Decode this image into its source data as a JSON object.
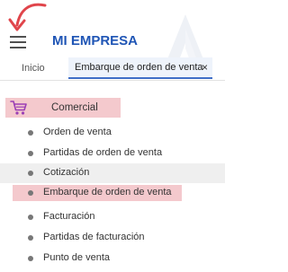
{
  "header": {
    "brand": "MI EMPRESA"
  },
  "tabs": {
    "home": "Inicio",
    "active": "Embarque de orden de venta",
    "close": "×"
  },
  "section": {
    "label": "Comercial",
    "icon": "shopping-cart-icon"
  },
  "menu": {
    "items": [
      {
        "label": "Orden de venta",
        "state": "normal"
      },
      {
        "label": "Partidas de orden de venta",
        "state": "normal"
      },
      {
        "label": "Cotización",
        "state": "hover"
      },
      {
        "label": "Embarque de orden de venta",
        "state": "highlighted"
      },
      {
        "label": "Facturación",
        "state": "normal"
      },
      {
        "label": "Partidas de facturación",
        "state": "normal"
      },
      {
        "label": "Punto de venta",
        "state": "normal"
      }
    ]
  },
  "colors": {
    "brand": "#1f55b5",
    "highlight": "#f4c9cd",
    "annotation": "#e0454b",
    "active_tab_bg": "#eef3fb"
  }
}
